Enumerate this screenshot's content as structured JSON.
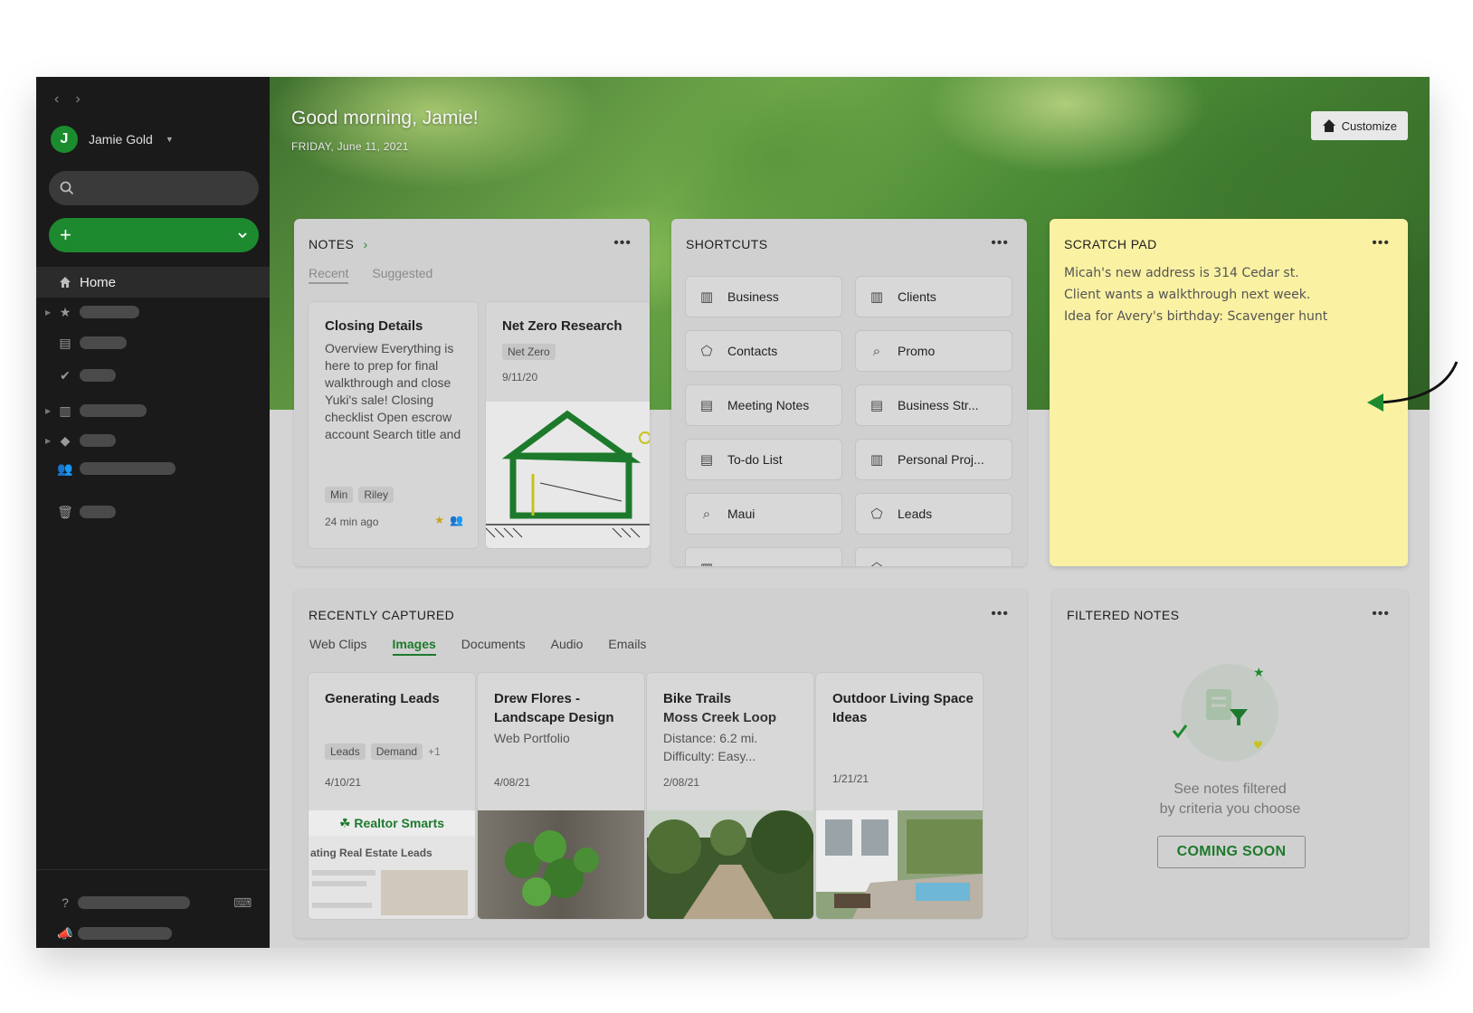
{
  "sidebar": {
    "user_initial": "J",
    "user_name": "Jamie Gold",
    "home_label": "Home"
  },
  "hero": {
    "greeting": "Good morning, Jamie!",
    "date": "FRIDAY, June 11, 2021",
    "customize_label": "Customize"
  },
  "notes": {
    "title": "NOTES",
    "tabs": [
      "Recent",
      "Suggested"
    ],
    "items": [
      {
        "title": "Closing Details",
        "body": "Overview Everything is here to prep for final walkthrough and close Yuki's sale! Closing checklist Open escrow account Search title and",
        "tags": [
          "Min",
          "Riley"
        ],
        "date": "24 min ago"
      },
      {
        "title": "Net Zero Research",
        "tag": "Net Zero",
        "date": "9/11/20"
      }
    ]
  },
  "shortcuts": {
    "title": "SHORTCUTS",
    "items": [
      {
        "label": "Business",
        "icon": "notebook-icon"
      },
      {
        "label": "Clients",
        "icon": "notebook-icon"
      },
      {
        "label": "Contacts",
        "icon": "tag-icon"
      },
      {
        "label": "Promo",
        "icon": "search-icon"
      },
      {
        "label": "Meeting Notes",
        "icon": "note-icon"
      },
      {
        "label": "Business Str...",
        "icon": "note-icon"
      },
      {
        "label": "To-do List",
        "icon": "note-icon"
      },
      {
        "label": "Personal Proj...",
        "icon": "notebook-icon"
      },
      {
        "label": "Maui",
        "icon": "search-icon"
      },
      {
        "label": "Leads",
        "icon": "tag-icon"
      }
    ]
  },
  "scratch": {
    "title": "SCRATCH PAD",
    "lines": [
      "Micah's new address is 314 Cedar st.",
      "Client wants a walkthrough next week.",
      "Idea for Avery's birthday: Scavenger hunt"
    ]
  },
  "captured": {
    "title": "RECENTLY CAPTURED",
    "tabs": [
      "Web Clips",
      "Images",
      "Documents",
      "Audio",
      "Emails"
    ],
    "active_tab": "Images",
    "items": [
      {
        "title": "Generating Leads",
        "tags": [
          "Leads",
          "Demand"
        ],
        "more": "+1",
        "date": "4/10/21",
        "brand": "Realtor Smarts",
        "clip_heading": "ating Real Estate Leads"
      },
      {
        "title": "Drew Flores - Landscape Design",
        "sub": "Web Portfolio",
        "date": "4/08/21"
      },
      {
        "title": "Bike Trails",
        "sub_lines": [
          "Moss Creek Loop",
          "Distance: 6.2 mi.",
          "Difficulty: Easy..."
        ],
        "date": "2/08/21"
      },
      {
        "title": "Outdoor Living Space Ideas",
        "date": "1/21/21"
      }
    ]
  },
  "filtered": {
    "title": "FILTERED NOTES",
    "line1": "See notes filtered",
    "line2": "by criteria you choose",
    "button": "COMING SOON"
  },
  "colors": {
    "accent_green": "#1d8a2f",
    "sidebar_bg": "#1a1a1a",
    "scratch_bg": "#faf1a3"
  }
}
